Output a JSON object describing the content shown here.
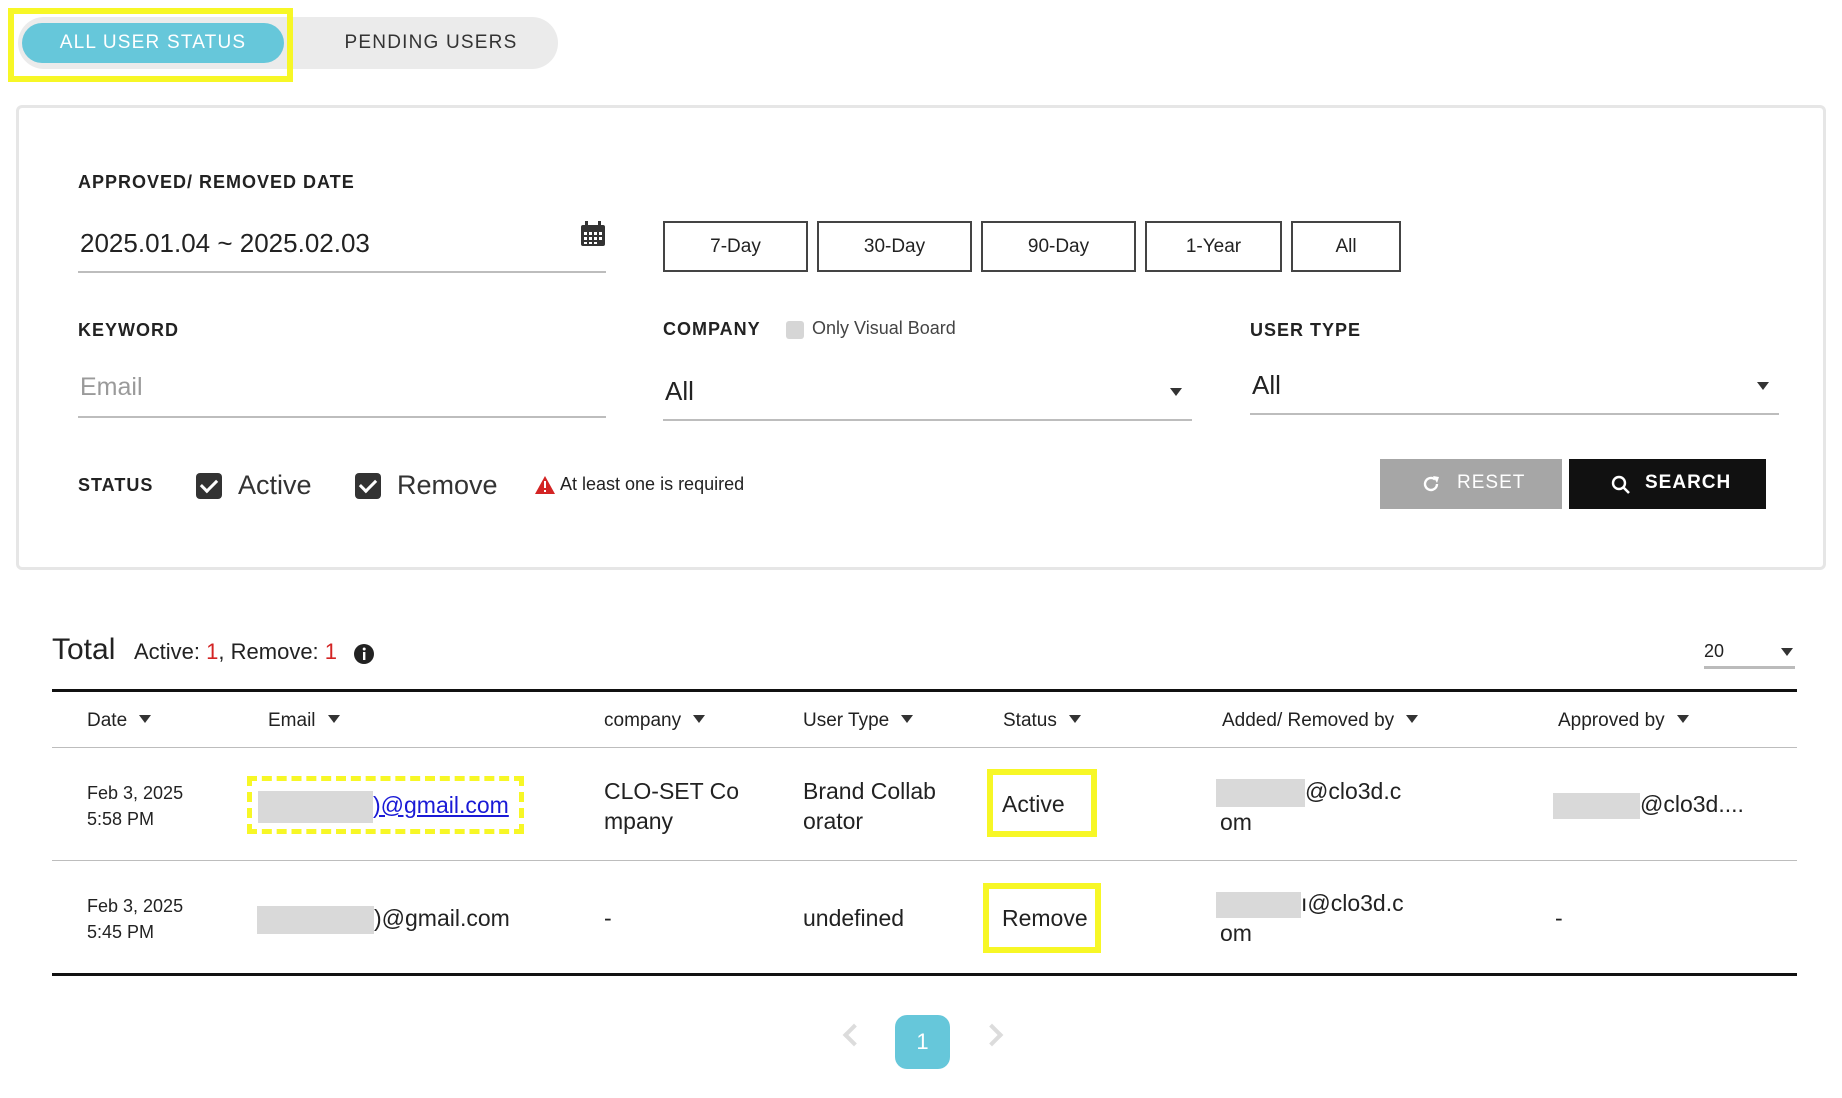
{
  "tabs": [
    {
      "label": "ALL USER STATUS",
      "active": true
    },
    {
      "label": "PENDING USERS",
      "active": false
    }
  ],
  "filters": {
    "date_label": "APPROVED/ REMOVED DATE",
    "date_value": "2025.01.04 ~ 2025.02.03",
    "quick_ranges": [
      "7-Day",
      "30-Day",
      "90-Day",
      "1-Year",
      "All"
    ],
    "keyword_label": "KEYWORD",
    "keyword_placeholder": "Email",
    "company_label": "COMPANY",
    "only_visual_board": "Only Visual Board",
    "company_value": "All",
    "user_type_label": "USER TYPE",
    "user_type_value": "All",
    "status_label": "STATUS",
    "status_active": "Active",
    "status_remove": "Remove",
    "warning": "At least one is required",
    "reset_label": "RESET",
    "search_label": "SEARCH"
  },
  "summary": {
    "total_label": "Total",
    "active_label": "Active:",
    "active_count": "1",
    "remove_label": ", Remove:",
    "remove_count": "1",
    "page_size": "20"
  },
  "table": {
    "columns": [
      "Date",
      "Email",
      "company",
      "User Type",
      "Status",
      "Added/ Removed by",
      "Approved by"
    ],
    "rows": [
      {
        "date": "Feb 3, 2025",
        "time": "5:58 PM",
        "email_suffix": ")@gmail.com",
        "company_l1": "CLO-SET Co",
        "company_l2": "mpany",
        "user_type_l1": "Brand Collab",
        "user_type_l2": "orator",
        "status": "Active",
        "added_l1": "@clo3d.c",
        "added_l2": "om",
        "approved": "@clo3d...."
      },
      {
        "date": "Feb 3, 2025",
        "time": "5:45 PM",
        "email_suffix": ")@gmail.com",
        "company": "-",
        "user_type": "undefined",
        "status": "Remove",
        "added_l1": "ı@clo3d.c",
        "added_l2": "om",
        "approved": "-"
      }
    ]
  },
  "pagination": {
    "current": "1"
  },
  "colors": {
    "accent": "#66c7da",
    "active": "#3fa02a",
    "remove": "#d32424",
    "highlight": "#f7f726"
  }
}
